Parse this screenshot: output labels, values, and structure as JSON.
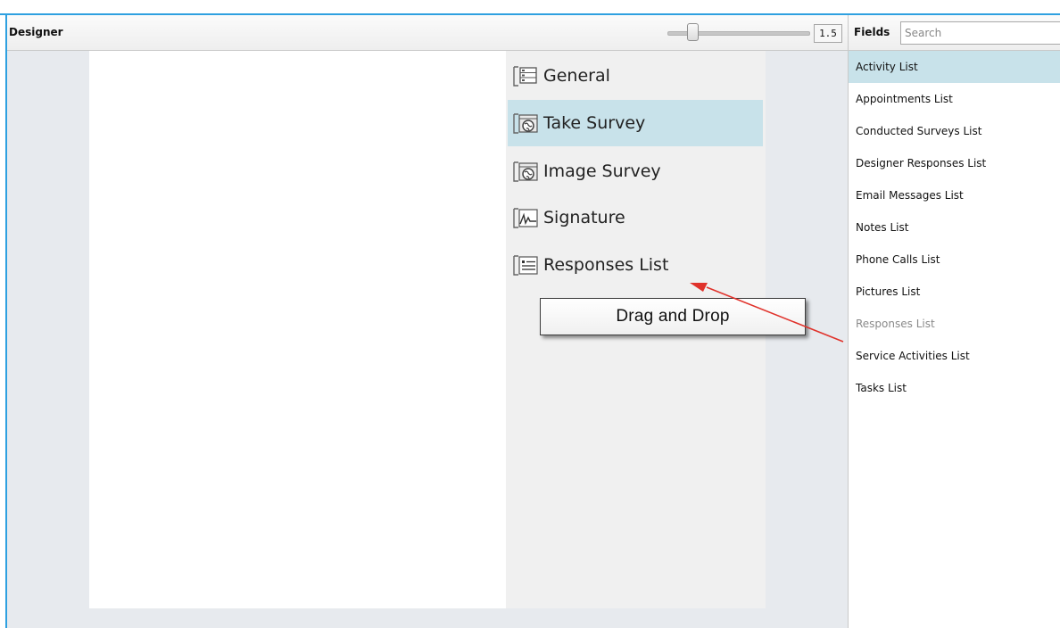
{
  "designer": {
    "title": "Designer",
    "zoom_value": "1.5",
    "zoom_level": 1.5
  },
  "controls": [
    {
      "label": "General",
      "icon": "general-form-icon",
      "selected": false
    },
    {
      "label": "Take Survey",
      "icon": "survey-globe-icon",
      "selected": true
    },
    {
      "label": "Image Survey",
      "icon": "survey-globe-icon",
      "selected": false
    },
    {
      "label": "Signature",
      "icon": "signature-icon",
      "selected": false
    },
    {
      "label": "Responses List",
      "icon": "list-icon",
      "selected": false
    }
  ],
  "annotation": {
    "text": "Drag and Drop",
    "arrow_color": "#e0322b"
  },
  "fields": {
    "title": "Fields",
    "search_placeholder": "Search",
    "items": [
      {
        "label": "Activity List",
        "state": "selected"
      },
      {
        "label": "Appointments List",
        "state": "normal"
      },
      {
        "label": "Conducted Surveys List",
        "state": "normal"
      },
      {
        "label": "Designer Responses List",
        "state": "normal"
      },
      {
        "label": "Email Messages List",
        "state": "normal"
      },
      {
        "label": "Notes List",
        "state": "normal"
      },
      {
        "label": "Phone Calls List",
        "state": "normal"
      },
      {
        "label": "Pictures List",
        "state": "normal"
      },
      {
        "label": "Responses List",
        "state": "disabled"
      },
      {
        "label": "Service Activities List",
        "state": "normal"
      },
      {
        "label": "Tasks List",
        "state": "normal"
      }
    ]
  },
  "colors": {
    "accent_border": "#2ea0e0",
    "selection": "#c8e2ea"
  }
}
